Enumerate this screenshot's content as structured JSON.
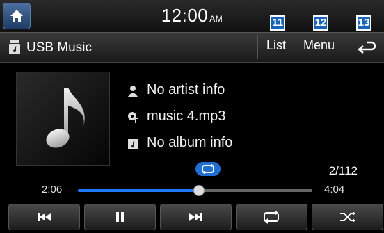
{
  "status": {
    "time": "12:00",
    "ampm": "AM"
  },
  "titlebar": {
    "source_title": "USB Music",
    "list_label": "List",
    "menu_label": "Menu",
    "badges": [
      "11",
      "12",
      "13"
    ]
  },
  "track": {
    "artist": "No artist info",
    "title": "music 4.mp3",
    "album": "No album info",
    "count": "2/112"
  },
  "playback": {
    "elapsed": "2:06",
    "total": "4:04",
    "progress": 0.516
  },
  "controls": [
    "previous",
    "pause",
    "next",
    "repeat",
    "shuffle"
  ],
  "colors": {
    "accent": "#1e78ff",
    "badge": "#1565c0"
  }
}
